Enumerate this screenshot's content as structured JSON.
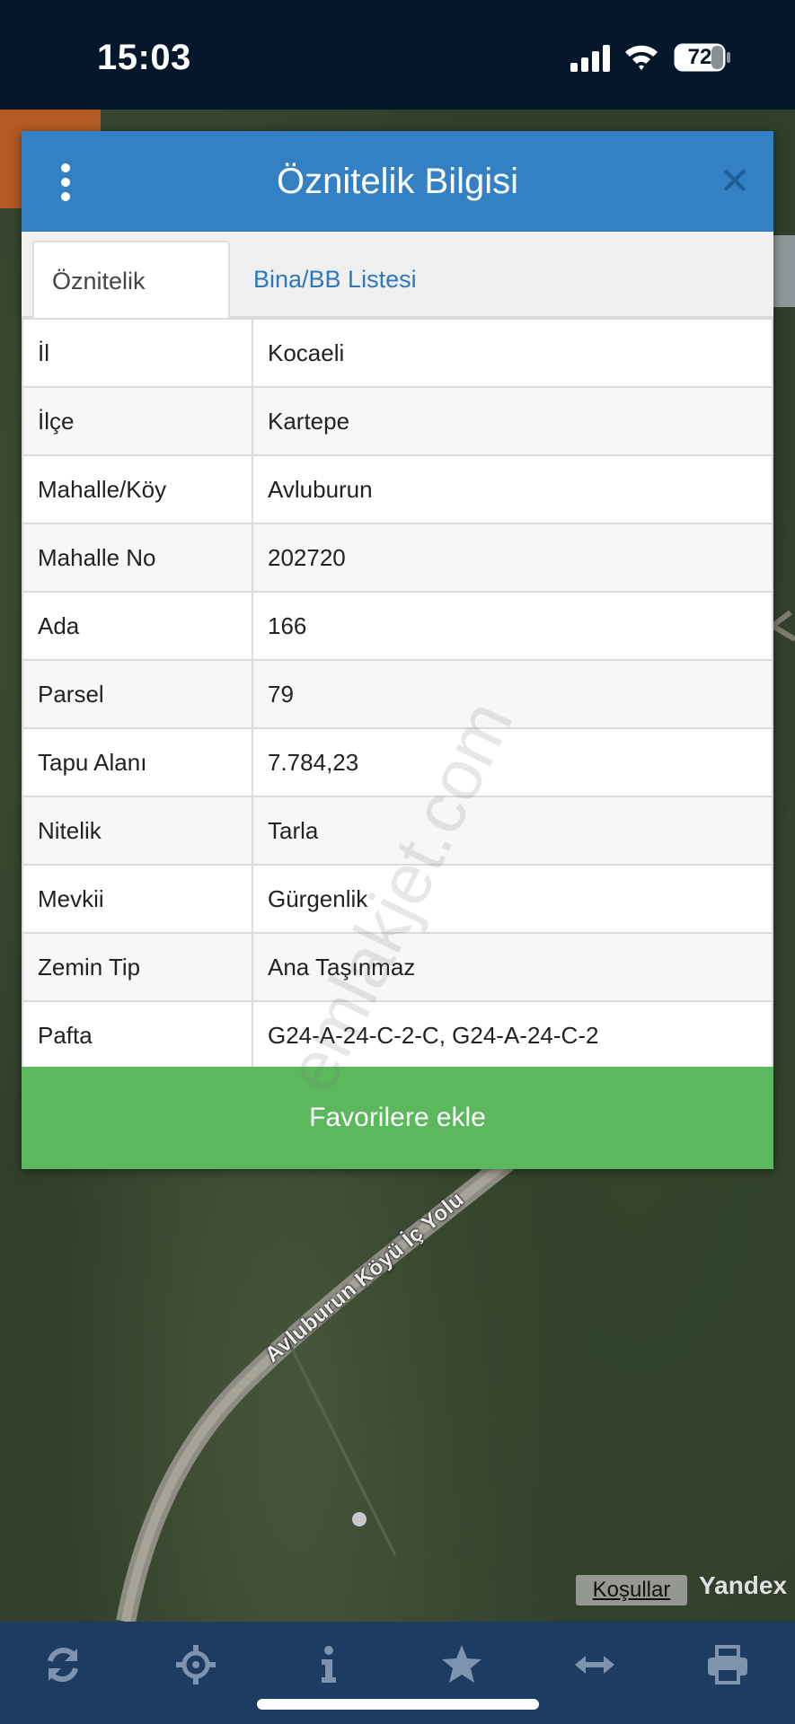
{
  "status_bar": {
    "time": "15:03",
    "battery": "72"
  },
  "dialog": {
    "title": "Öznitelik Bilgisi",
    "close_label": "✕",
    "tabs": [
      {
        "label": "Öznitelik Bilgisi",
        "active": true
      },
      {
        "label": "Bina/BB Listesi",
        "active": false
      }
    ],
    "rows": [
      {
        "key": "İl",
        "value": "Kocaeli"
      },
      {
        "key": "İlçe",
        "value": "Kartepe"
      },
      {
        "key": "Mahalle/Köy",
        "value": "Avluburun"
      },
      {
        "key": "Mahalle No",
        "value": "202720"
      },
      {
        "key": "Ada",
        "value": "166"
      },
      {
        "key": "Parsel",
        "value": "79"
      },
      {
        "key": "Tapu Alanı",
        "value": "7.784,23"
      },
      {
        "key": "Nitelik",
        "value": "Tarla"
      },
      {
        "key": "Mevkii",
        "value": "Gürgenlik"
      },
      {
        "key": "Zemin Tip",
        "value": "Ana Taşınmaz"
      },
      {
        "key": "Pafta",
        "value": "G24-A-24-C-2-C, G24-A-24-C-2"
      }
    ],
    "favorite_label": "Favorilere ekle"
  },
  "watermark": "emlakjet.com",
  "map": {
    "road_label": "Avluburun Köyü İç Yolu",
    "terms_label": "Koşullar",
    "provider": "Yandex"
  },
  "toolbar": {
    "icons": [
      "refresh-icon",
      "locate-icon",
      "info-icon",
      "star-icon",
      "measure-icon",
      "print-icon"
    ]
  },
  "colors": {
    "header": "#3380c4",
    "favorite": "#5cb85c",
    "toolbar": "#1c3c62",
    "tab_link": "#2f78bc"
  }
}
